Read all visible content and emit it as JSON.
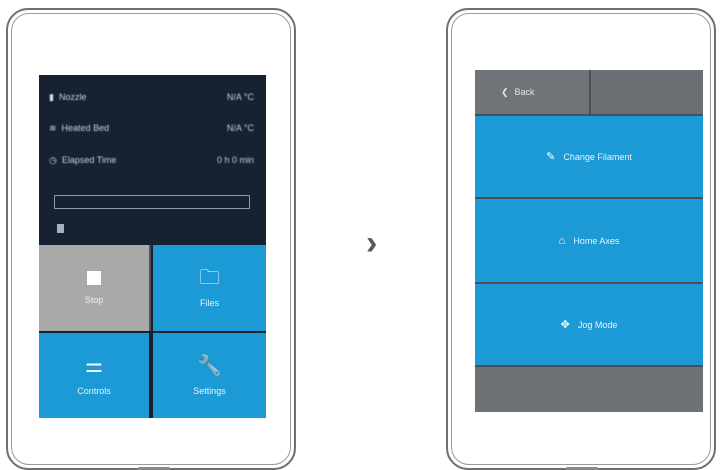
{
  "left_screen": {
    "status": [
      {
        "icon": "nozzle-icon",
        "label": "Nozzle",
        "value": "N/A °C"
      },
      {
        "icon": "heatbed-icon",
        "label": "Heated Bed",
        "value": "N/A °C"
      },
      {
        "icon": "clock-icon",
        "label": "Elapsed Time",
        "value": "0 h 0 min"
      }
    ],
    "progress": 0,
    "tiles": {
      "stop": "Stop",
      "files": "Files",
      "controls": "Controls",
      "settings": "Settings"
    }
  },
  "arrow": "›",
  "right_screen": {
    "back": "Back",
    "buttons": [
      "Change Filament",
      "Home Axes",
      "Jog Mode"
    ]
  },
  "colors": {
    "dark_bg": "#162230",
    "accent_blue": "#1b9ad6",
    "grey_tile": "#a9a9a9",
    "grey_bar": "#6c6f73"
  }
}
